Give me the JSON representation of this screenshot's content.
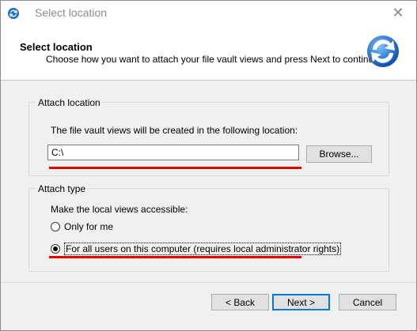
{
  "window": {
    "title": "Select location",
    "close_glyph": "✕"
  },
  "header": {
    "title": "Select location",
    "subtitle": "Choose how you want to attach your file vault views and press Next to continue.",
    "icon": "refresh-arrows-icon"
  },
  "attach_location": {
    "legend": "Attach location",
    "description": "The file vault views will be created in the following location:",
    "path_value": "C:\\",
    "browse_label": "Browse..."
  },
  "attach_type": {
    "legend": "Attach type",
    "description": "Make the local views accessible:",
    "options": [
      {
        "label": "Only for me",
        "selected": false
      },
      {
        "label": "For all users on this computer (requires local administrator rights)",
        "selected": true
      }
    ]
  },
  "footer": {
    "back_label": "< Back",
    "next_label": "Next >",
    "cancel_label": "Cancel"
  },
  "colors": {
    "annotation_red": "#e60000",
    "default_button_border": "#0078d7"
  }
}
